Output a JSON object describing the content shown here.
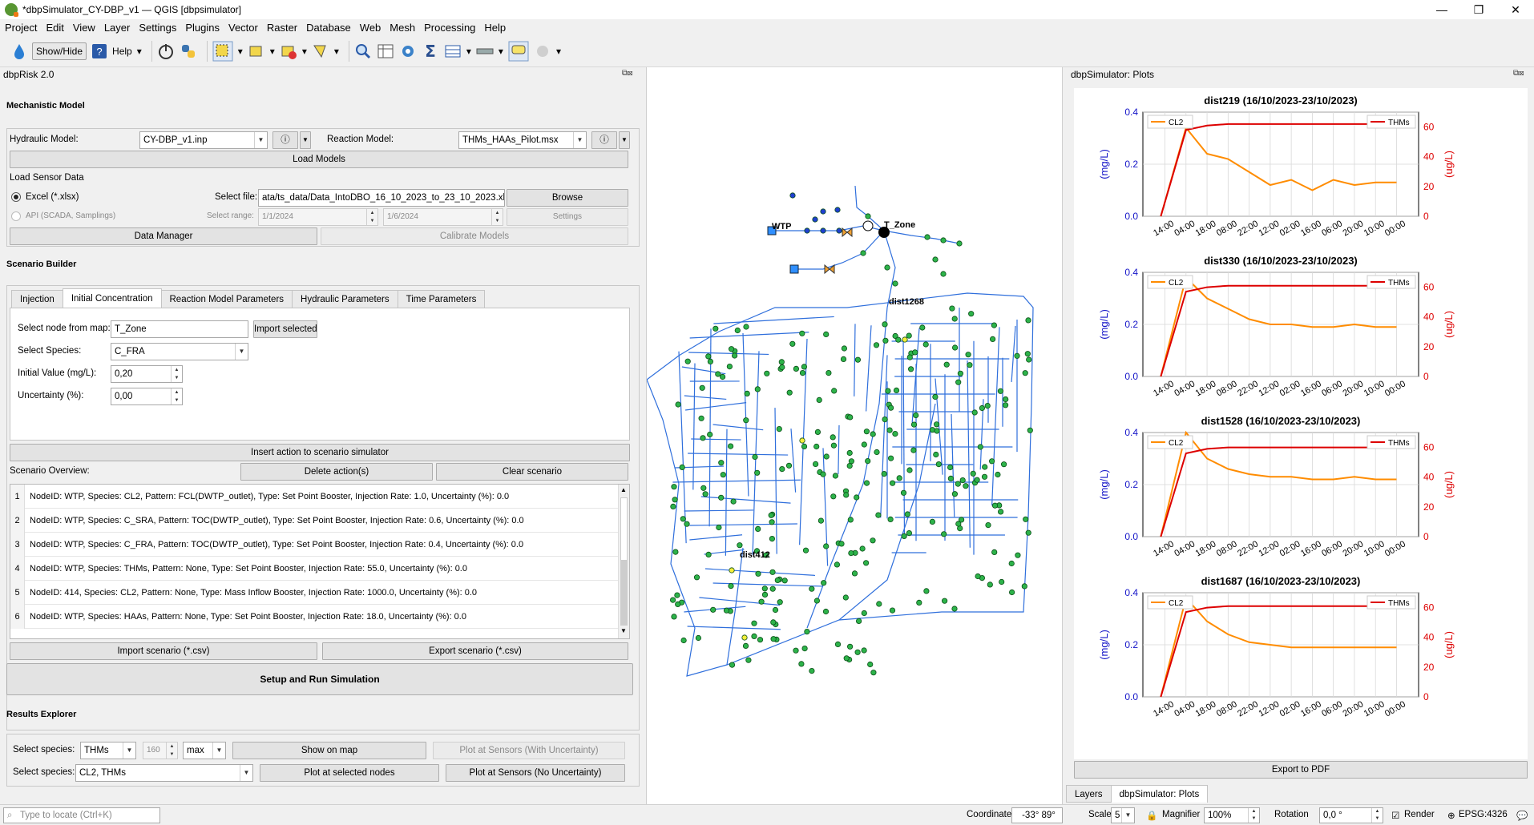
{
  "window": {
    "title": "*dbpSimulator_CY-DBP_v1 — QGIS [dbpsimulator]",
    "minimize": "—",
    "maximize": "❐",
    "close": "✕"
  },
  "menu": [
    "Project",
    "Edit",
    "View",
    "Layer",
    "Settings",
    "Plugins",
    "Vector",
    "Raster",
    "Database",
    "Web",
    "Mesh",
    "Processing",
    "Help"
  ],
  "toolbar": {
    "show_hide": "Show/Hide",
    "help": "Help"
  },
  "left_panel": {
    "title": "dbpRisk 2.0",
    "mechanistic": {
      "title": "Mechanistic Model",
      "hydraulic_label": "Hydraulic Model:",
      "hydraulic_value": "CY-DBP_v1.inp",
      "reaction_label": "Reaction Model:",
      "reaction_value": "THMs_HAAs_Pilot.msx",
      "load_models": "Load Models",
      "sensor_title": "Load Sensor Data",
      "excel_label": "Excel (*.xlsx)",
      "select_file_label": "Select file:",
      "file_value": "ata/ts_data/Data_IntoDBO_16_10_2023_to_23_10_2023.xlsx",
      "browse": "Browse",
      "api_label": "API (SCADA, Samplings)",
      "range_label": "Select range:",
      "range_start": "1/1/2024",
      "range_end": "1/6/2024",
      "settings": "Settings",
      "data_manager": "Data Manager",
      "calibrate": "Calibrate Models"
    },
    "scenario": {
      "title": "Scenario Builder",
      "tabs": [
        "Injection",
        "Initial Concentration",
        "Reaction Model Parameters",
        "Hydraulic Parameters",
        "Time Parameters"
      ],
      "node_label": "Select node from map:",
      "node_value": "T_Zone",
      "import_selected": "Import selected",
      "species_label": "Select Species:",
      "species_value": "C_FRA",
      "initial_label": "Initial Value (mg/L):",
      "initial_value": "0,20",
      "uncert_label": "Uncertainty (%):",
      "uncert_value": "0,00",
      "insert_action": "Insert action to scenario simulator",
      "overview_label": "Scenario Overview:",
      "delete_action": "Delete action(s)",
      "clear_scenario": "Clear scenario",
      "rows": [
        {
          "n": "1",
          "t": "NodeID: WTP, Species: CL2, Pattern: FCL(DWTP_outlet), Type: Set Point Booster, Injection Rate: 1.0, Uncertainty (%): 0.0"
        },
        {
          "n": "2",
          "t": "NodeID: WTP, Species: C_SRA, Pattern: TOC(DWTP_outlet), Type: Set Point Booster, Injection Rate: 0.6, Uncertainty (%): 0.0"
        },
        {
          "n": "3",
          "t": "NodeID: WTP, Species: C_FRA, Pattern: TOC(DWTP_outlet), Type: Set Point Booster, Injection Rate: 0.4, Uncertainty (%): 0.0"
        },
        {
          "n": "4",
          "t": "NodeID: WTP, Species: THMs, Pattern: None, Type: Set Point Booster, Injection Rate: 55.0, Uncertainty (%): 0.0"
        },
        {
          "n": "5",
          "t": "NodeID: 414, Species: CL2, Pattern: None, Type: Mass Inflow Booster, Injection Rate: 1000.0, Uncertainty (%): 0.0"
        },
        {
          "n": "6",
          "t": "NodeID: WTP, Species: HAAs, Pattern: None, Type: Set Point Booster, Injection Rate: 18.0, Uncertainty (%): 0.0"
        }
      ],
      "import_scenario": "Import scenario (*.csv)",
      "export_scenario": "Export scenario (*.csv)",
      "run": "Setup and Run Simulation"
    },
    "results": {
      "title": "Results Explorer",
      "species_label": "Select species:",
      "species_value": "THMs",
      "steps_value": "160",
      "agg_value": "max",
      "show_on_map": "Show on map",
      "plot_unc": "Plot at Sensors (With Uncertainty)",
      "species2_label": "Select species:",
      "species2_value": "CL2, THMs",
      "plot_nodes": "Plot at selected nodes",
      "plot_no_unc": "Plot at Sensors (No Uncertainty)"
    }
  },
  "map": {
    "labels": {
      "wtp": "WTP",
      "tzone": "T_Zone",
      "dist1268": "dist1268",
      "dist412": "dist412"
    }
  },
  "right_panel": {
    "title": "dbpSimulator: Plots",
    "export_pdf": "Export to PDF",
    "tab_layers": "Layers",
    "tab_plots": "dbpSimulator: Plots"
  },
  "chart_data": [
    {
      "type": "line",
      "title": "dist219 (16/10/2023-23/10/2023)",
      "ylabel": "(mg/L)",
      "y2label": "(ug/L)",
      "ylim": [
        0,
        0.4
      ],
      "y2lim": [
        0,
        70
      ],
      "x": [
        "14:00",
        "04:00",
        "18:00",
        "08:00",
        "22:00",
        "12:00",
        "02:00",
        "16:00",
        "06:00",
        "20:00",
        "10:00",
        "00:00"
      ],
      "series": [
        {
          "name": "CL2",
          "color": "#ff8c00",
          "axis": "left",
          "values": [
            0.0,
            0.34,
            0.24,
            0.22,
            0.17,
            0.12,
            0.14,
            0.1,
            0.14,
            0.12,
            0.13,
            0.13
          ]
        },
        {
          "name": "THMs",
          "color": "#dd0000",
          "axis": "right",
          "values": [
            0,
            58,
            61,
            62,
            62,
            62,
            62,
            62,
            62,
            62,
            62,
            62
          ]
        }
      ]
    },
    {
      "type": "line",
      "title": "dist330 (16/10/2023-23/10/2023)",
      "ylabel": "(mg/L)",
      "y2label": "(ug/L)",
      "ylim": [
        0,
        0.4
      ],
      "y2lim": [
        0,
        70
      ],
      "x": [
        "14:00",
        "04:00",
        "18:00",
        "08:00",
        "22:00",
        "12:00",
        "02:00",
        "16:00",
        "06:00",
        "20:00",
        "10:00",
        "00:00"
      ],
      "series": [
        {
          "name": "CL2",
          "color": "#ff8c00",
          "axis": "left",
          "values": [
            0.0,
            0.38,
            0.3,
            0.26,
            0.22,
            0.2,
            0.2,
            0.19,
            0.19,
            0.2,
            0.19,
            0.19
          ]
        },
        {
          "name": "THMs",
          "color": "#dd0000",
          "axis": "right",
          "values": [
            0,
            57,
            60,
            61,
            61,
            61,
            61,
            61,
            61,
            61,
            61,
            61
          ]
        }
      ]
    },
    {
      "type": "line",
      "title": "dist1528 (16/10/2023-23/10/2023)",
      "ylabel": "(mg/L)",
      "y2label": "(ug/L)",
      "ylim": [
        0,
        0.4
      ],
      "y2lim": [
        0,
        70
      ],
      "x": [
        "14:00",
        "04:00",
        "18:00",
        "08:00",
        "22:00",
        "12:00",
        "02:00",
        "16:00",
        "06:00",
        "20:00",
        "10:00",
        "00:00"
      ],
      "series": [
        {
          "name": "CL2",
          "color": "#ff8c00",
          "axis": "left",
          "values": [
            0.0,
            0.4,
            0.3,
            0.26,
            0.24,
            0.23,
            0.23,
            0.22,
            0.22,
            0.23,
            0.22,
            0.22
          ]
        },
        {
          "name": "THMs",
          "color": "#dd0000",
          "axis": "right",
          "values": [
            0,
            56,
            59,
            60,
            60,
            60,
            60,
            60,
            60,
            60,
            60,
            60
          ]
        }
      ]
    },
    {
      "type": "line",
      "title": "dist1687 (16/10/2023-23/10/2023)",
      "ylabel": "(mg/L)",
      "y2label": "(ug/L)",
      "ylim": [
        0,
        0.4
      ],
      "y2lim": [
        0,
        70
      ],
      "x": [
        "14:00",
        "04:00",
        "18:00",
        "08:00",
        "22:00",
        "12:00",
        "02:00",
        "16:00",
        "06:00",
        "20:00",
        "10:00",
        "00:00"
      ],
      "series": [
        {
          "name": "CL2",
          "color": "#ff8c00",
          "axis": "left",
          "values": [
            0.0,
            0.38,
            0.29,
            0.24,
            0.21,
            0.2,
            0.19,
            0.19,
            0.19,
            0.19,
            0.19,
            0.19
          ]
        },
        {
          "name": "THMs",
          "color": "#dd0000",
          "axis": "right",
          "values": [
            0,
            57,
            60,
            61,
            61,
            61,
            61,
            61,
            61,
            61,
            61,
            61
          ]
        }
      ]
    }
  ],
  "status": {
    "locate_placeholder": "Type to locate (Ctrl+K)",
    "coord_label": "Coordinate",
    "coord_value": "-33° 89°",
    "scale_label": "Scale",
    "scale_value": "5",
    "magnifier_label": "Magnifier",
    "magnifier_value": "100%",
    "rotation_label": "Rotation",
    "rotation_value": "0,0 °",
    "render_label": "Render",
    "crs": "EPSG:4326"
  }
}
